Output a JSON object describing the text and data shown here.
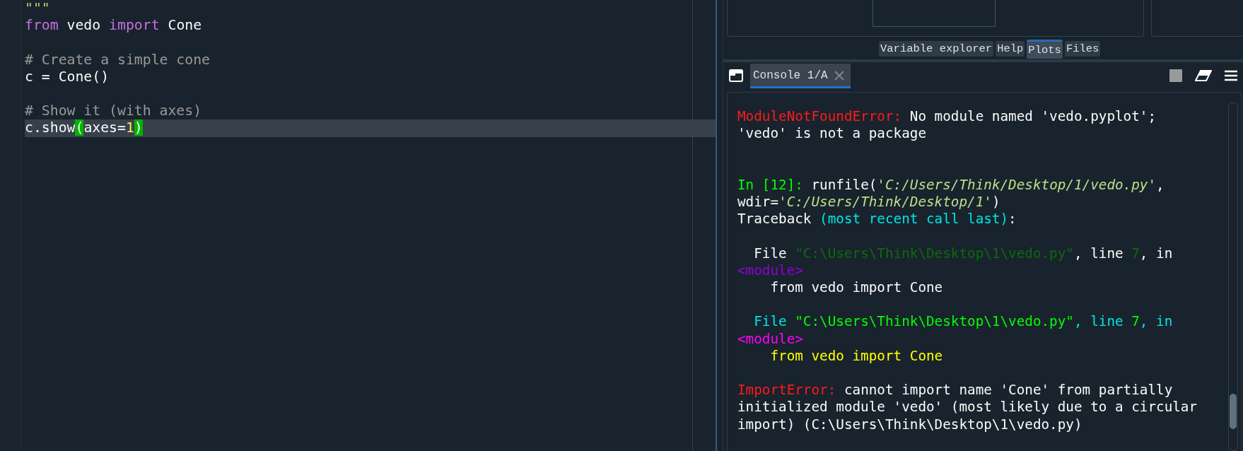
{
  "editor": {
    "blocks": [
      {
        "lines": [
          {
            "current": false,
            "segments": [
              {
                "kind": "string",
                "text": "\"\"\""
              }
            ]
          },
          {
            "current": false,
            "segments": [
              {
                "kind": "keyword",
                "text": "from"
              },
              {
                "kind": "plain",
                "text": " vedo "
              },
              {
                "kind": "keyword",
                "text": "import"
              },
              {
                "kind": "plain",
                "text": " Cone"
              }
            ]
          }
        ]
      },
      {
        "lines": [
          {
            "current": false,
            "segments": [
              {
                "kind": "comment",
                "text": "# Create a simple cone"
              }
            ]
          },
          {
            "current": false,
            "segments": [
              {
                "kind": "plain",
                "text": "c = Cone()"
              }
            ]
          }
        ]
      },
      {
        "lines": [
          {
            "current": false,
            "segments": [
              {
                "kind": "comment",
                "text": "# Show it (with axes)"
              }
            ]
          },
          {
            "current": true,
            "segments": [
              {
                "kind": "plain",
                "text": "c.show"
              },
              {
                "kind": "match",
                "text": "("
              },
              {
                "kind": "plain",
                "text": "axes="
              },
              {
                "kind": "number",
                "text": "1"
              },
              {
                "kind": "match",
                "text": ")"
              }
            ]
          }
        ]
      }
    ]
  },
  "pane_tabs": [
    {
      "label": "Variable explorer",
      "selected": false
    },
    {
      "label": "Help",
      "selected": false
    },
    {
      "label": "Plots",
      "selected": true
    },
    {
      "label": "Files",
      "selected": false
    }
  ],
  "console": {
    "tab": {
      "label": "Console 1/A",
      "selected": true
    },
    "blocks": [
      {
        "kind": "output",
        "lines": [
          [
            {
              "kind": "error",
              "text": "ModuleNotFoundError:"
            },
            {
              "kind": "plain",
              "text": " No module named 'vedo.pyplot';"
            }
          ],
          [
            {
              "kind": "plain",
              "text": "'vedo' is not a package"
            }
          ]
        ]
      },
      {
        "kind": "input",
        "lines": [
          [
            {
              "kind": "prompt",
              "text": "In [12]:"
            },
            {
              "kind": "plain",
              "text": " runfile("
            },
            {
              "kind": "string",
              "text": "'C:/Users/Think/Desktop/1/vedo.py'"
            },
            {
              "kind": "plain",
              "text": ","
            }
          ],
          [
            {
              "kind": "plain",
              "text": "wdir="
            },
            {
              "kind": "string",
              "text": "'C:/Users/Think/Desktop/1'"
            },
            {
              "kind": "plain",
              "text": ")"
            }
          ],
          [
            {
              "kind": "plain",
              "text": "Traceback "
            },
            {
              "kind": "cyan",
              "text": "(most recent call last)"
            },
            {
              "kind": "plain",
              "text": ":"
            }
          ]
        ]
      },
      {
        "kind": "output",
        "lines": [
          [
            {
              "kind": "plain",
              "text": "  File "
            },
            {
              "kind": "dim_green",
              "text": "\"C:\\Users\\Think\\Desktop\\1\\vedo.py\""
            },
            {
              "kind": "plain",
              "text": ", line "
            },
            {
              "kind": "dim_green",
              "text": "7"
            },
            {
              "kind": "plain",
              "text": ", in"
            }
          ],
          [
            {
              "kind": "purple",
              "text": "<module>"
            }
          ],
          [
            {
              "kind": "plain",
              "text": "    from vedo import Cone"
            }
          ]
        ]
      },
      {
        "kind": "output",
        "lines": [
          [
            {
              "kind": "cyan",
              "text": "  File "
            },
            {
              "kind": "green",
              "text": "\"C:\\Users\\Think\\Desktop\\1\\vedo.py\""
            },
            {
              "kind": "cyan",
              "text": ", line "
            },
            {
              "kind": "green",
              "text": "7"
            },
            {
              "kind": "cyan",
              "text": ", in"
            }
          ],
          [
            {
              "kind": "magenta",
              "text": "<module>"
            }
          ],
          [
            {
              "kind": "yellow",
              "text": "    from vedo import Cone"
            }
          ]
        ]
      },
      {
        "kind": "output",
        "lines": [
          [
            {
              "kind": "error",
              "text": "ImportError:"
            },
            {
              "kind": "plain",
              "text": " cannot import name 'Cone' from partially"
            }
          ],
          [
            {
              "kind": "plain",
              "text": "initialized module 'vedo' (most likely due to a circular"
            }
          ],
          [
            {
              "kind": "plain",
              "text": "import) (C:\\Users\\Think\\Desktop\\1\\vedo.py)"
            }
          ]
        ]
      }
    ]
  }
}
